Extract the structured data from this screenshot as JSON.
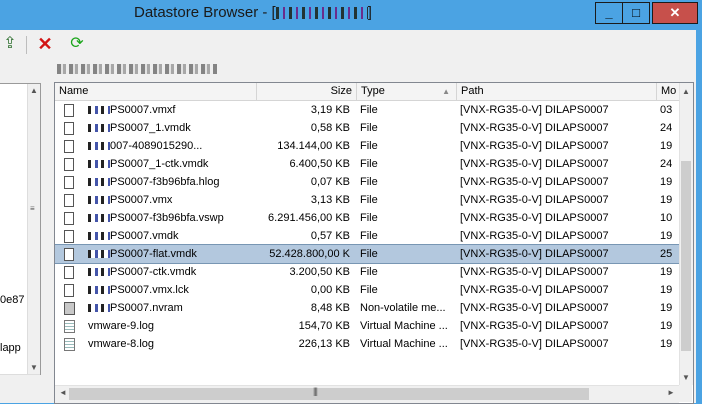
{
  "window": {
    "title": "Datastore Browser - [",
    "title_tail": "]",
    "controls": {
      "minimize": "_",
      "maximize": "□",
      "close": "✕"
    }
  },
  "toolbar": {
    "upload_icon": "upload-file-icon",
    "delete_icon": "delete-icon",
    "refresh_icon": "refresh-icon"
  },
  "left_pane": {
    "text1": "0e87",
    "text2": "lapp"
  },
  "columns": {
    "name": "Name",
    "size": "Size",
    "type": "Type",
    "path": "Path",
    "modified": "Mo"
  },
  "files": [
    {
      "name": "PS0007.vmxf",
      "size": "3,19 KB",
      "type": "File",
      "path": "[VNX-RG35-0-V] DILAPS0007",
      "mod": "03",
      "icon": "file"
    },
    {
      "name": "PS0007_1.vmdk",
      "size": "0,58 KB",
      "type": "File",
      "path": "[VNX-RG35-0-V] DILAPS0007",
      "mod": "24",
      "icon": "file"
    },
    {
      "name": "007-4089015290...",
      "size": "134.144,00 KB",
      "type": "File",
      "path": "[VNX-RG35-0-V] DILAPS0007",
      "mod": "19",
      "icon": "file"
    },
    {
      "name": "PS0007_1-ctk.vmdk",
      "size": "6.400,50 KB",
      "type": "File",
      "path": "[VNX-RG35-0-V] DILAPS0007",
      "mod": "24",
      "icon": "file"
    },
    {
      "name": "PS0007-f3b96bfa.hlog",
      "size": "0,07 KB",
      "type": "File",
      "path": "[VNX-RG35-0-V] DILAPS0007",
      "mod": "19",
      "icon": "file"
    },
    {
      "name": "PS0007.vmx",
      "size": "3,13 KB",
      "type": "File",
      "path": "[VNX-RG35-0-V] DILAPS0007",
      "mod": "19",
      "icon": "file"
    },
    {
      "name": "PS0007-f3b96bfa.vswp",
      "size": "6.291.456,00 KB",
      "type": "File",
      "path": "[VNX-RG35-0-V] DILAPS0007",
      "mod": "10",
      "icon": "file"
    },
    {
      "name": "PS0007.vmdk",
      "size": "0,57 KB",
      "type": "File",
      "path": "[VNX-RG35-0-V] DILAPS0007",
      "mod": "19",
      "icon": "file"
    },
    {
      "name": "PS0007-flat.vmdk",
      "size": "52.428.800,00 K",
      "type": "File",
      "path": "[VNX-RG35-0-V] DILAPS0007",
      "mod": "25",
      "icon": "file",
      "selected": true
    },
    {
      "name": "PS0007-ctk.vmdk",
      "size": "3.200,50 KB",
      "type": "File",
      "path": "[VNX-RG35-0-V] DILAPS0007",
      "mod": "19",
      "icon": "file"
    },
    {
      "name": "PS0007.vmx.lck",
      "size": "0,00 KB",
      "type": "File",
      "path": "[VNX-RG35-0-V] DILAPS0007",
      "mod": "19",
      "icon": "file"
    },
    {
      "name": "PS0007.nvram",
      "size": "8,48 KB",
      "type": "Non-volatile me...",
      "path": "[VNX-RG35-0-V] DILAPS0007",
      "mod": "19",
      "icon": "nvram"
    },
    {
      "name": "vmware-9.log",
      "size": "154,70 KB",
      "type": "Virtual Machine ...",
      "path": "[VNX-RG35-0-V] DILAPS0007",
      "mod": "19",
      "icon": "log"
    },
    {
      "name": "vmware-8.log",
      "size": "226,13 KB",
      "type": "Virtual Machine ...",
      "path": "[VNX-RG35-0-V] DILAPS0007",
      "mod": "19",
      "icon": "log"
    }
  ]
}
